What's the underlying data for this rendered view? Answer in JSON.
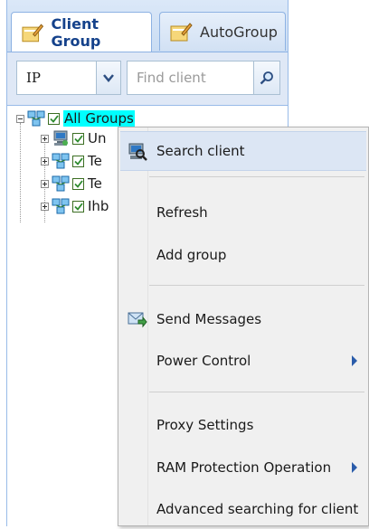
{
  "tabs": [
    {
      "label": "Client Group",
      "icon": "edit-group-icon",
      "active": true
    },
    {
      "label": "AutoGroup",
      "icon": "edit-group-icon",
      "active": false
    }
  ],
  "toolbar": {
    "filter_value": "IP",
    "search_placeholder": "Find client"
  },
  "tree": {
    "root": {
      "label": "All Groups",
      "checked": true
    },
    "children": [
      {
        "label": "Un",
        "checked": true,
        "icon": "computer-group-icon"
      },
      {
        "label": "Te",
        "checked": true,
        "icon": "network-group-icon"
      },
      {
        "label": "Te",
        "checked": true,
        "icon": "network-group-icon"
      },
      {
        "label": "Ihb",
        "checked": true,
        "icon": "network-group-icon"
      }
    ]
  },
  "context_menu": {
    "items": [
      {
        "label": "Search client",
        "icon": "search-client-icon",
        "highlighted": true
      },
      {
        "label": "Refresh"
      },
      {
        "label": "Add group"
      },
      {
        "label": "Send Messages",
        "icon": "send-message-icon"
      },
      {
        "label": "Power Control",
        "submenu": true
      },
      {
        "label": "Proxy Settings"
      },
      {
        "label": "RAM Protection Operation",
        "submenu": true
      },
      {
        "label": "Advanced searching for client"
      }
    ]
  },
  "colors": {
    "selection": "#00ffff",
    "accent": "#15428b",
    "menu_bg": "#f0f0f0",
    "menu_highlight": "#dce6f4"
  }
}
